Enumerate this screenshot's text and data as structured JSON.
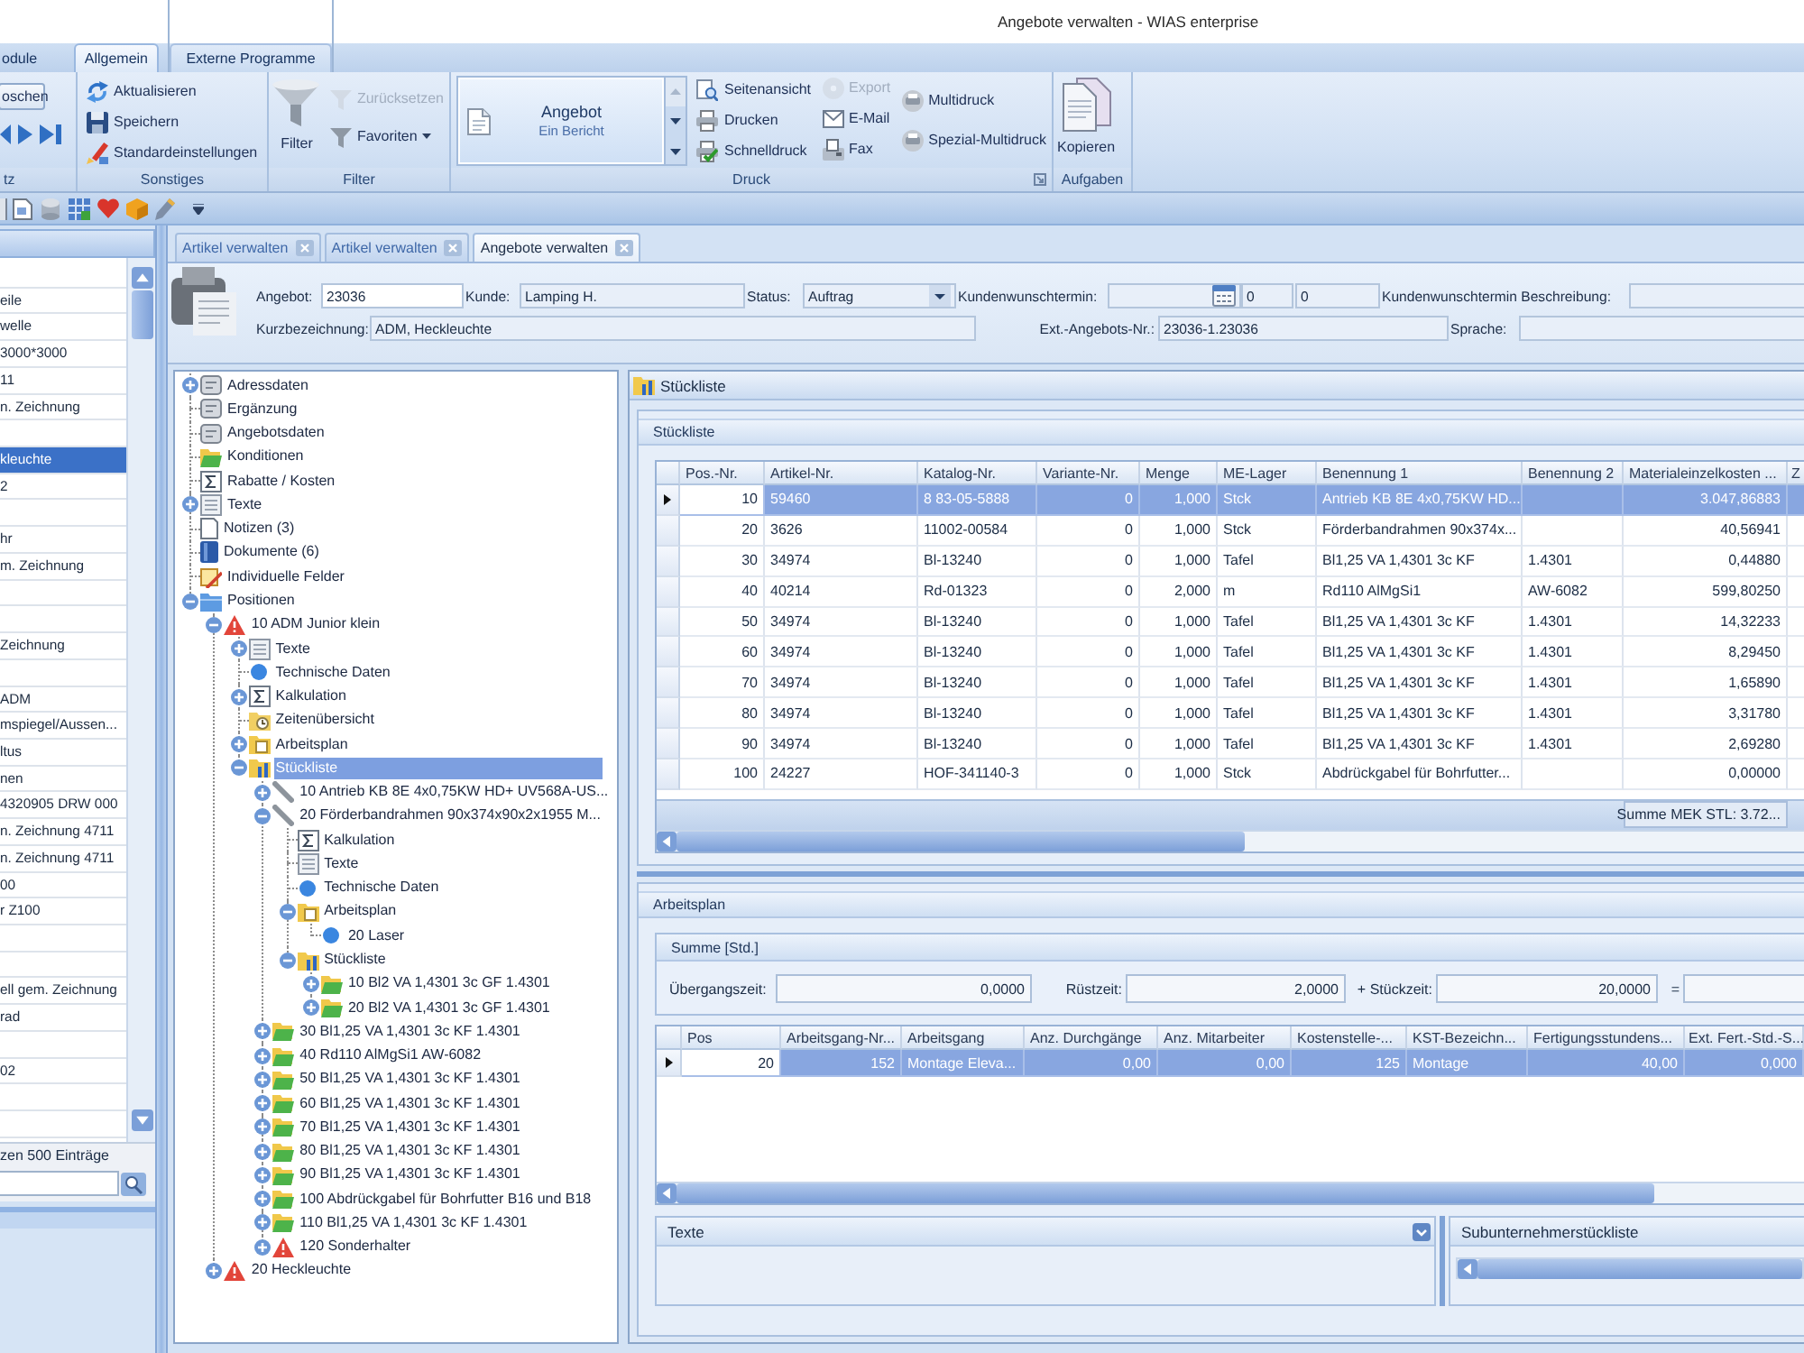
{
  "window": {
    "title": "Angebote verwalten - WIAS enterprise"
  },
  "ribbon": {
    "tabs": [
      {
        "label": "odule",
        "selected": false
      },
      {
        "label": "Allgemein",
        "selected": true
      },
      {
        "label": "Externe Programme",
        "selected": false
      }
    ],
    "record_group": {
      "label": "tz",
      "button": "oschen"
    },
    "misc_group": {
      "label": "Sonstiges",
      "buttons": [
        {
          "label": "Aktualisieren",
          "disabled": false
        },
        {
          "label": "Speichern",
          "disabled": false
        },
        {
          "label": "Standardeinstellungen",
          "disabled": false
        }
      ]
    },
    "filter_group": {
      "label": "Filter",
      "buttons": [
        {
          "label": "Filter",
          "disabled": false
        },
        {
          "label": "Zurücksetzen",
          "disabled": true
        },
        {
          "label": "Favoriten",
          "disabled": false
        }
      ]
    },
    "print_group": {
      "label": "Druck",
      "gallery": {
        "title": "Angebot",
        "subtitle": "Ein Bericht"
      },
      "buttons": [
        {
          "label": "Seitenansicht",
          "disabled": false
        },
        {
          "label": "Drucken",
          "disabled": false
        },
        {
          "label": "Schnelldruck",
          "disabled": false
        },
        {
          "label": "Export",
          "disabled": true
        },
        {
          "label": "E-Mail",
          "disabled": false
        },
        {
          "label": "Fax",
          "disabled": false
        },
        {
          "label": "Multidruck",
          "disabled": false
        },
        {
          "label": "Spezial-Multidruck",
          "disabled": false
        }
      ]
    },
    "tasks_group": {
      "label": "Aufgaben",
      "buttons": [
        {
          "label": "Kopieren",
          "disabled": false
        }
      ]
    }
  },
  "sidebar": {
    "items": [
      {
        "selected": false
      },
      {
        "label": "eile",
        "selected": false
      },
      {
        "label": "welle",
        "selected": false
      },
      {
        "label": "3000*3000",
        "selected": false
      },
      {
        "label": "11",
        "selected": false
      },
      {
        "label": "n. Zeichnung",
        "selected": false
      },
      {
        "selected": false
      },
      {
        "label": "kleuchte",
        "selected": true
      },
      {
        "label": "2",
        "selected": false
      },
      {
        "selected": false
      },
      {
        "label": "hr",
        "selected": false
      },
      {
        "label": "m. Zeichnung",
        "selected": false
      },
      {
        "selected": false
      },
      {
        "selected": false
      },
      {
        "label": "Zeichnung",
        "selected": false
      },
      {
        "selected": false
      },
      {
        "label": "ADM",
        "selected": false
      },
      {
        "label": "mspiegel/Aussen...",
        "selected": false
      },
      {
        "label": "ltus",
        "selected": false
      },
      {
        "label": "nen",
        "selected": false
      },
      {
        "label": "4320905 DRW 000",
        "selected": false
      },
      {
        "label": "n. Zeichnung 4711",
        "selected": false
      },
      {
        "label": "n. Zeichnung 4711",
        "selected": false
      },
      {
        "label": "00",
        "selected": false
      },
      {
        "label": "r Z100",
        "selected": false
      },
      {
        "selected": false
      },
      {
        "selected": false
      },
      {
        "label": "ell gem. Zeichnung",
        "selected": false
      },
      {
        "label": "rad",
        "selected": false
      },
      {
        "selected": false
      },
      {
        "label": "02",
        "selected": false
      },
      {
        "selected": false
      },
      {
        "selected": false
      }
    ],
    "footer": "zen 500 Einträge"
  },
  "document_tabs": [
    {
      "label": "Artikel verwalten",
      "selected": false
    },
    {
      "label": "Artikel verwalten",
      "selected": false
    },
    {
      "label": "Angebote verwalten",
      "selected": true
    }
  ],
  "offer_header": {
    "first_line": [
      {
        "label": "Angebot:",
        "kind": "text",
        "value": "23036",
        "editable": true
      },
      {
        "label": "Kunde:",
        "kind": "text",
        "value": "Lamping H.",
        "editable": false
      },
      {
        "label": "Status:",
        "kind": "dropdown",
        "value": "Auftrag",
        "editable": false
      },
      {
        "label": "Kundenwunschtermin:",
        "kind": "date",
        "editable": false,
        "more_values": [
          "0",
          "0"
        ]
      },
      {
        "label": "Kundenwunschtermin Beschreibung:",
        "kind": "text",
        "editable": false
      }
    ],
    "second_line": [
      {
        "label": "Kurzbezeichnung:",
        "kind": "text",
        "value": "ADM, Heckleuchte",
        "editable": false
      },
      {
        "label": "Ext.-Angebots-Nr.:",
        "kind": "text",
        "value": "23036-1.23036",
        "editable": false
      },
      {
        "label": "Sprache:",
        "kind": "text",
        "editable": false
      }
    ]
  },
  "tree": [
    {
      "label": "Adressdaten",
      "kind": "record",
      "expanded": false,
      "selected": false
    },
    {
      "label": "Ergänzung",
      "kind": "record",
      "selected": false
    },
    {
      "label": "Angebotsdaten",
      "kind": "record",
      "selected": false
    },
    {
      "label": "Konditionen",
      "kind": "conditions",
      "selected": false
    },
    {
      "label": "Rabatte / Kosten",
      "kind": "costs",
      "selected": false
    },
    {
      "label": "Texte",
      "kind": "texts",
      "expanded": false,
      "selected": false
    },
    {
      "label": "Notizen (3)",
      "kind": "notes",
      "selected": false
    },
    {
      "label": "Dokumente (6)",
      "kind": "documents",
      "selected": false
    },
    {
      "label": "Individuelle Felder",
      "kind": "fields",
      "selected": false
    },
    {
      "label": "Positionen",
      "kind": "positions",
      "expanded": true,
      "selected": false,
      "children": [
        {
          "label": "10 ADM Junior klein",
          "kind": "flagged",
          "expanded": true,
          "selected": false,
          "children": [
            {
              "label": "Texte",
              "kind": "texts",
              "expanded": false,
              "selected": false
            },
            {
              "label": "Technische Daten",
              "kind": "technical",
              "selected": false
            },
            {
              "label": "Kalkulation",
              "kind": "costs",
              "expanded": false,
              "selected": false
            },
            {
              "label": "Zeitenübersicht",
              "kind": "times",
              "selected": false
            },
            {
              "label": "Arbeitsplan",
              "kind": "plan",
              "expanded": false,
              "selected": false
            },
            {
              "label": "Stückliste",
              "kind": "bom",
              "expanded": true,
              "selected": true,
              "children": [
                {
                  "label": "10 Antrieb KB 8E 4x0,75KW HD+ UV568A-US...",
                  "kind": "part",
                  "expanded": false,
                  "selected": false
                },
                {
                  "label": "20 Förderbandrahmen 90x374x90x2x1955 M...",
                  "kind": "part",
                  "expanded": true,
                  "selected": false,
                  "children": [
                    {
                      "label": "Kalkulation",
                      "kind": "costs",
                      "selected": false
                    },
                    {
                      "label": "Texte",
                      "kind": "texts",
                      "selected": false
                    },
                    {
                      "label": "Technische Daten",
                      "kind": "technical",
                      "selected": false
                    },
                    {
                      "label": "Arbeitsplan",
                      "kind": "plan",
                      "expanded": true,
                      "selected": false,
                      "children": [
                        {
                          "label": "20 Laser",
                          "kind": "operation",
                          "selected": false
                        }
                      ]
                    },
                    {
                      "label": "Stückliste",
                      "kind": "bom",
                      "expanded": true,
                      "selected": false,
                      "children": [
                        {
                          "label": "10 Bl2 VA 1,4301 3c GF 1.4301",
                          "kind": "material",
                          "expanded": false,
                          "selected": false
                        },
                        {
                          "label": "20 Bl2 VA 1,4301 3c GF 1.4301",
                          "kind": "material",
                          "expanded": false,
                          "selected": false
                        }
                      ]
                    }
                  ]
                },
                {
                  "label": "30 Bl1,25 VA 1,4301 3c KF 1.4301",
                  "kind": "material",
                  "expanded": false,
                  "selected": false
                },
                {
                  "label": "40 Rd110 AlMgSi1 AW-6082",
                  "kind": "material",
                  "expanded": false,
                  "selected": false
                },
                {
                  "label": "50 Bl1,25 VA 1,4301 3c KF 1.4301",
                  "kind": "material",
                  "expanded": false,
                  "selected": false
                },
                {
                  "label": "60 Bl1,25 VA 1,4301 3c KF 1.4301",
                  "kind": "material",
                  "expanded": false,
                  "selected": false
                },
                {
                  "label": "70 Bl1,25 VA 1,4301 3c KF 1.4301",
                  "kind": "material",
                  "expanded": false,
                  "selected": false
                },
                {
                  "label": "80 Bl1,25 VA 1,4301 3c KF 1.4301",
                  "kind": "material",
                  "expanded": false,
                  "selected": false
                },
                {
                  "label": "90 Bl1,25 VA 1,4301 3c KF 1.4301",
                  "kind": "material",
                  "expanded": false,
                  "selected": false
                },
                {
                  "label": "100 Abdrückgabel für Bohrfutter B16 und B18",
                  "kind": "material",
                  "expanded": false,
                  "selected": false
                },
                {
                  "label": "110 Bl1,25 VA 1,4301 3c KF 1.4301",
                  "kind": "material",
                  "expanded": false,
                  "selected": false
                },
                {
                  "label": "120 Sonderhalter",
                  "kind": "flagged",
                  "expanded": false,
                  "selected": false
                }
              ]
            }
          ]
        },
        {
          "label": "20 Heckleuchte",
          "kind": "flagged",
          "expanded": false,
          "selected": false
        }
      ]
    }
  ],
  "bom_panel": {
    "title": "Stückliste",
    "group_title": "Stückliste",
    "table": {
      "columns": [
        "Pos.-Nr.",
        "Artikel-Nr.",
        "Katalog-Nr.",
        "Variante-Nr.",
        "Menge",
        "ME-Lager",
        "Benennung 1",
        "Benennung 2",
        "Materialeinzelkosten ...",
        "Z"
      ],
      "rows": [
        {
          "selected": true,
          "cells": [
            "10",
            "59460",
            "8 83-05-5888",
            "0",
            "1,000",
            "Stck",
            "Antrieb KB 8E 4x0,75KW HD...",
            null,
            "3.047,86883"
          ]
        },
        {
          "selected": false,
          "cells": [
            "20",
            "3626",
            "11002-00584",
            "0",
            "1,000",
            "Stck",
            "Förderbandrahmen 90x374x...",
            null,
            "40,56941"
          ]
        },
        {
          "selected": false,
          "cells": [
            "30",
            "34974",
            "Bl-13240",
            "0",
            "1,000",
            "Tafel",
            "Bl1,25 VA 1,4301 3c KF",
            "1.4301",
            "0,44880"
          ]
        },
        {
          "selected": false,
          "cells": [
            "40",
            "40214",
            "Rd-01323",
            "0",
            "2,000",
            "m",
            "Rd110 AlMgSi1",
            "AW-6082",
            "599,80250"
          ]
        },
        {
          "selected": false,
          "cells": [
            "50",
            "34974",
            "Bl-13240",
            "0",
            "1,000",
            "Tafel",
            "Bl1,25 VA 1,4301 3c KF",
            "1.4301",
            "14,32233"
          ]
        },
        {
          "selected": false,
          "cells": [
            "60",
            "34974",
            "Bl-13240",
            "0",
            "1,000",
            "Tafel",
            "Bl1,25 VA 1,4301 3c KF",
            "1.4301",
            "8,29450"
          ]
        },
        {
          "selected": false,
          "cells": [
            "70",
            "34974",
            "Bl-13240",
            "0",
            "1,000",
            "Tafel",
            "Bl1,25 VA 1,4301 3c KF",
            "1.4301",
            "1,65890"
          ]
        },
        {
          "selected": false,
          "cells": [
            "80",
            "34974",
            "Bl-13240",
            "0",
            "1,000",
            "Tafel",
            "Bl1,25 VA 1,4301 3c KF",
            "1.4301",
            "3,31780"
          ]
        },
        {
          "selected": false,
          "cells": [
            "90",
            "34974",
            "Bl-13240",
            "0",
            "1,000",
            "Tafel",
            "Bl1,25 VA 1,4301 3c KF",
            "1.4301",
            "2,69280"
          ]
        },
        {
          "selected": false,
          "cells": [
            "100",
            "24227",
            "HOF-341140-3",
            "0",
            "1,000",
            "Stck",
            "Abdrückgabel für Bohrfutter...",
            null,
            "0,00000"
          ]
        }
      ],
      "summary": "Summe MEK STL: 3.72..."
    }
  },
  "work_plan": {
    "title": "Arbeitsplan",
    "sum_group": {
      "title": "Summe [Std.]",
      "fields": [
        {
          "label": "Übergangszeit:",
          "value": "0,0000"
        },
        {
          "label": "Rüstzeit:",
          "value": "2,0000"
        },
        {
          "label": "+ Stückzeit:",
          "value": "20,0000"
        },
        {
          "label": "="
        }
      ]
    },
    "table": {
      "columns": [
        "Pos",
        "Arbeitsgang-Nr...",
        "Arbeitsgang",
        "Anz. Durchgänge",
        "Anz. Mitarbeiter",
        "Kostenstelle-...",
        "KST-Bezeichn...",
        "Fertigungsstundens...",
        "Ext. Fert.-Std.-S..."
      ],
      "rows": [
        {
          "selected": true,
          "cells": [
            "20",
            "152",
            "Montage Eleva...",
            "0,00",
            "0,00",
            "125",
            "Montage",
            "40,00",
            "0,000"
          ]
        }
      ]
    }
  },
  "texts_panel": {
    "title": "Texte"
  },
  "subcontractor_panel": {
    "title": "Subunternehmerstückliste"
  }
}
